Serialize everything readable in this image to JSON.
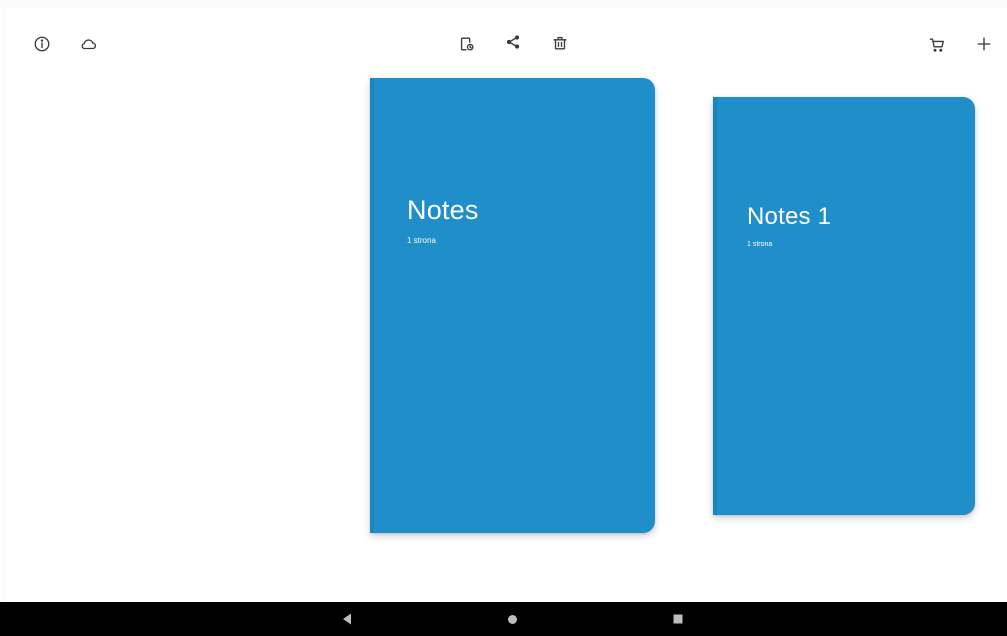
{
  "toolbar": {
    "left_icons": [
      "info-icon",
      "cloud-icon"
    ],
    "center_icons": [
      "notebook-settings-icon",
      "share-icon",
      "trash-icon"
    ],
    "right_icons": [
      "cart-icon",
      "plus-icon"
    ]
  },
  "notebooks": [
    {
      "title": "Notes",
      "subtitle": "1 strona",
      "color": "#1f8ec9"
    },
    {
      "title": "Notes 1",
      "subtitle": "1 strona",
      "color": "#1f8ec9"
    }
  ],
  "navbar": {
    "buttons": [
      "back-icon",
      "home-icon",
      "recents-icon"
    ]
  }
}
